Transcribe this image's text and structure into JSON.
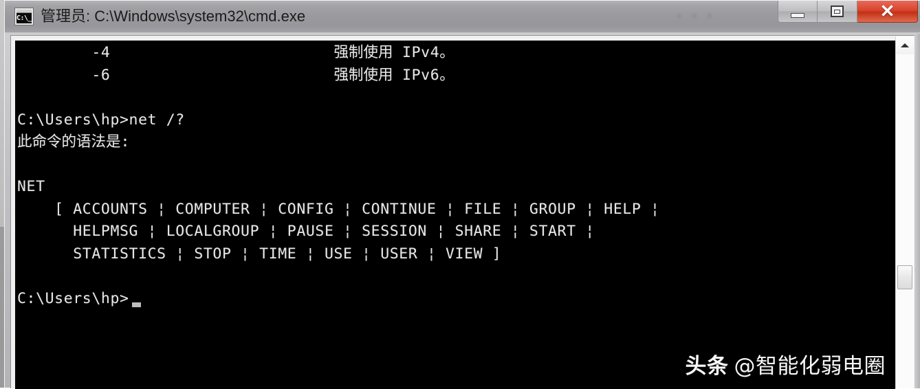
{
  "window": {
    "title": "管理员: C:\\Windows\\system32\\cmd.exe",
    "icon_name": "cmd-console-icon",
    "icon_glyph": "C:\\_",
    "titlebar_watermark": "• • •",
    "controls": {
      "minimize_label": "—",
      "maximize_label": "❐",
      "close_label": "✕"
    },
    "colors": {
      "titlebar": "#9a9a9e",
      "close_button": "#d8432c",
      "console_background": "#000000",
      "console_foreground": "#e6e6e6"
    }
  },
  "console": {
    "lines": [
      "        -4                        强制使用 IPv4。",
      "        -6                        强制使用 IPv6。",
      "",
      "C:\\Users\\hp>net /?",
      "此命令的语法是:",
      "",
      "NET",
      "    [ ACCOUNTS ¦ COMPUTER ¦ CONFIG ¦ CONTINUE ¦ FILE ¦ GROUP ¦ HELP ¦",
      "      HELPMSG ¦ LOCALGROUP ¦ PAUSE ¦ SESSION ¦ SHARE ¦ START ¦",
      "      STATISTICS ¦ STOP ¦ TIME ¦ USE ¦ USER ¦ VIEW ]",
      "",
      "C:\\Users\\hp>"
    ],
    "text": "        -4                        强制使用 IPv4。\n        -6                        强制使用 IPv6。\n\nC:\\Users\\hp>net /?\n此命令的语法是:\n\nNET\n    [ ACCOUNTS ¦ COMPUTER ¦ CONFIG ¦ CONTINUE ¦ FILE ¦ GROUP ¦ HELP ¦\n      HELPMSG ¦ LOCALGROUP ¦ PAUSE ¦ SESSION ¦ SHARE ¦ START ¦\n      STATISTICS ¦ STOP ¦ TIME ¦ USE ¦ USER ¦ VIEW ]\n\nC:\\Users\\hp>",
    "command_entered": "net /?",
    "prompt": "C:\\Users\\hp>",
    "net_subcommands": [
      "ACCOUNTS",
      "COMPUTER",
      "CONFIG",
      "CONTINUE",
      "FILE",
      "GROUP",
      "HELP",
      "HELPMSG",
      "LOCALGROUP",
      "PAUSE",
      "SESSION",
      "SHARE",
      "START",
      "STATISTICS",
      "STOP",
      "TIME",
      "USE",
      "USER",
      "VIEW"
    ],
    "watermark_brand": "头条",
    "watermark_handle": "@智能化弱电圈"
  },
  "scrollbar": {
    "up_arrow": "▲"
  }
}
